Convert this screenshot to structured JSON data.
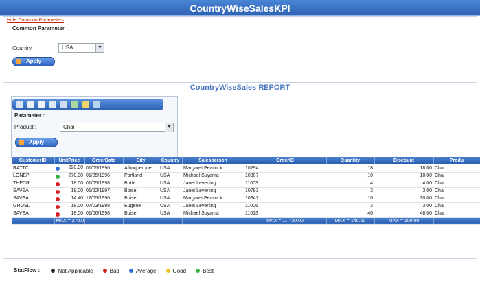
{
  "header": {
    "title": "CountryWiseSalesKPI"
  },
  "common": {
    "link": "Hide Common Parameters",
    "label": "Common Parameter :",
    "country_label": "Country :",
    "country_value": "USA",
    "apply_label": "Apply"
  },
  "report": {
    "title": "CountryWiseSales REPORT",
    "parameter_label": "Parameter :",
    "product_label": "Product :",
    "product_value": "Chai",
    "apply_label": "Apply",
    "toolbar_icons": [
      "first-page-icon",
      "previous-page-icon",
      "export-icon",
      "print-icon",
      "chart-icon",
      "refresh-icon",
      "filter-icon",
      "help-icon"
    ]
  },
  "table": {
    "columns": [
      "CustomerID",
      "UnitPrice",
      "OrderDate",
      "City",
      "Country",
      "Salesperson",
      "OrderID",
      "Quantity",
      "Discount",
      "Produ"
    ],
    "rows": [
      {
        "status": "#2f6fd6",
        "cells": [
          "RATTC",
          "220.00",
          "01/05/1996",
          "Albuquerque",
          "USA",
          "Margaret Peacock",
          "10294",
          "18",
          "18.00",
          "Chai"
        ]
      },
      {
        "status": "#3cb043",
        "cells": [
          "LONEP",
          "270.00",
          "01/05/1996",
          "Portland",
          "USA",
          "Michael Suyama",
          "10307",
          "10",
          "18.00",
          "Chai"
        ]
      },
      {
        "status": "#d42020",
        "cells": [
          "THECR",
          "18.00",
          "01/05/1998",
          "Butte",
          "USA",
          "Janet Leverling",
          "11003",
          "4",
          "4.00",
          "Chai"
        ]
      },
      {
        "status": "#d42020",
        "cells": [
          "SAVEA",
          "18.00",
          "01/22/1997",
          "Boise",
          "USA",
          "Janet Leverling",
          "10793",
          "3",
          "3.00",
          "Chai"
        ]
      },
      {
        "status": "#d42020",
        "cells": [
          "SAVEA",
          "14.40",
          "12/05/1996",
          "Boise",
          "USA",
          "Margaret Peacock",
          "10347",
          "10",
          "30.00",
          "Chai"
        ]
      },
      {
        "status": "#d42020",
        "cells": [
          "GROSL",
          "18.00",
          "07/03/1998",
          "Eugene",
          "USA",
          "Janet Leverling",
          "11006",
          "3",
          "3.00",
          "Chai"
        ]
      },
      {
        "status": "#d42020",
        "cells": [
          "SAVEA",
          "18.00",
          "01/06/1998",
          "Boise",
          "USA",
          "Michael Suyama",
          "11013",
          "40",
          "48.00",
          "Chai"
        ]
      }
    ],
    "footer": [
      "",
      "MAX = 270.00",
      "",
      "",
      "",
      "",
      "MAX = 11,730.00",
      "MAX = 140.00",
      "MAX = 100.00",
      ""
    ]
  },
  "legend": {
    "title": "StatFlow :",
    "items": [
      {
        "label": "Not Applicable",
        "color": "#222222"
      },
      {
        "label": "Bad",
        "color": "#d42020"
      },
      {
        "label": "Average",
        "color": "#2f6fd6"
      },
      {
        "label": "Good",
        "color": "#f2c318"
      },
      {
        "label": "Best",
        "color": "#3cb043"
      }
    ]
  }
}
